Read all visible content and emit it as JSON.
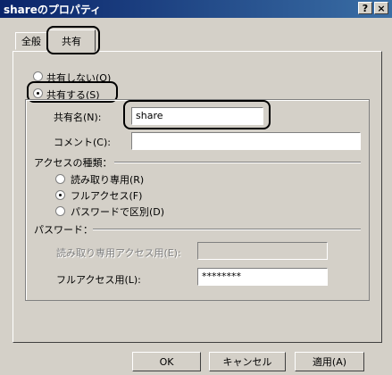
{
  "window": {
    "title": "shareのプロパティ",
    "help_label": "?",
    "close_label": "×"
  },
  "tabs": [
    {
      "label": "全般"
    },
    {
      "label": "共有"
    }
  ],
  "share": {
    "not_share_label": "共有しない(O)",
    "share_label": "共有する(S)",
    "share_selected": true,
    "share_name_label": "共有名(N):",
    "share_name_value": "share",
    "comment_label": "コメント(C):",
    "comment_value": ""
  },
  "access": {
    "section_label": "アクセスの種類：",
    "options": [
      {
        "label": "読み取り専用(R)",
        "selected": false
      },
      {
        "label": "フルアクセス(F)",
        "selected": true
      },
      {
        "label": "パスワードで区別(D)",
        "selected": false
      }
    ]
  },
  "password": {
    "section_label": "パスワード：",
    "readonly_label": "読み取り専用アクセス用(E):",
    "readonly_value": "",
    "full_label": "フルアクセス用(L):",
    "full_value": "********"
  },
  "buttons": {
    "ok": "OK",
    "cancel": "キャンセル",
    "apply": "適用(A)"
  }
}
